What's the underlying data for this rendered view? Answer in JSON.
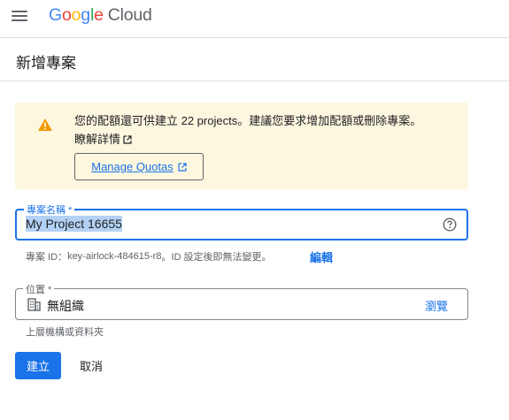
{
  "header": {
    "logo_letters": [
      "G",
      "o",
      "o",
      "g",
      "l",
      "e"
    ],
    "logo_product": "Cloud"
  },
  "page": {
    "title": "新增專案"
  },
  "quota_banner": {
    "message": "您的配額還可供建立 22 projects。建議您要求增加配額或刪除專案。",
    "learn_more": "瞭解詳情",
    "manage_button": "Manage Quotas",
    "background": "#fef7e0",
    "icon_color": "#f29900"
  },
  "project_name": {
    "label": "專案名稱 *",
    "value": "My Project 16655",
    "help_icon": "help-circle-icon"
  },
  "project_id": {
    "prefix": "專案 ID：",
    "value": "key-airlock-484615-r8",
    "suffix": "。ID 設定後即無法變更。",
    "edit_label": "編輯"
  },
  "location": {
    "label": "位置 *",
    "value": "無組織",
    "browse_label": "瀏覽",
    "helper": "上層機構或資料夾",
    "icon": "building-icon"
  },
  "actions": {
    "create_label": "建立",
    "cancel_label": "取消"
  },
  "colors": {
    "accent": "#1a73e8",
    "text": "#202124",
    "muted": "#5f6368"
  }
}
